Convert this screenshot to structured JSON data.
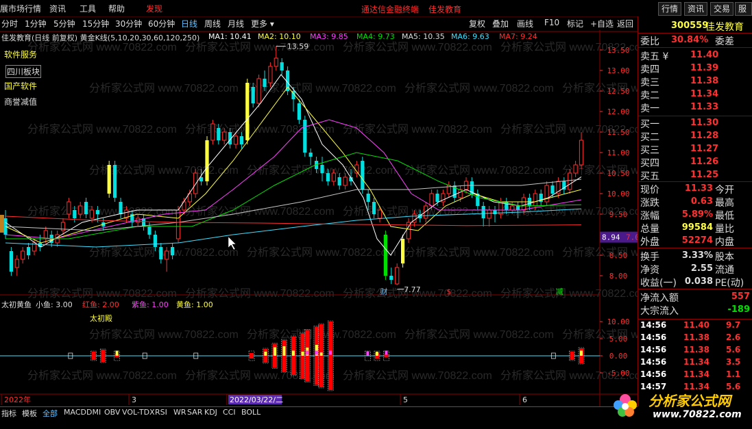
{
  "menu": {
    "items": [
      "展市场行情",
      "资讯",
      "工具",
      "帮助",
      "发现"
    ],
    "center_links": [
      "通达信金融终端",
      "佳发教育"
    ],
    "right_buttons": [
      "行情",
      "资讯",
      "交易",
      "服务"
    ]
  },
  "periods": [
    "分时",
    "1分钟",
    "5分钟",
    "15分钟",
    "30分钟",
    "60分钟",
    "日线",
    "周线",
    "月线",
    "更多 ▾"
  ],
  "active_period": "日线",
  "chart_tools": [
    "复权",
    "叠加",
    "画线",
    "F10",
    "标记",
    "+自选",
    "返回"
  ],
  "chart_title": "佳发教育(日线 前复权) 黄金K线(5,10,20,30,60,120,250)",
  "ma_labels": [
    {
      "text": "MA1: 10.41",
      "color": "#ffffff"
    },
    {
      "text": "MA2: 10.10",
      "color": "#ffff40"
    },
    {
      "text": "MA3: 9.85",
      "color": "#ff40ff"
    },
    {
      "text": "MA4: 9.73",
      "color": "#00e000"
    },
    {
      "text": "MA5: 10.35",
      "color": "#dddddd"
    },
    {
      "text": "MA6: 9.63",
      "color": "#40e0ff"
    },
    {
      "text": "MA7: 9.24",
      "color": "#ff3030"
    }
  ],
  "sectors": [
    "软件服务",
    "四川板块",
    "国产软件",
    "商誉减值"
  ],
  "price_axis": [
    "13.50",
    "13.00",
    "12.50",
    "12.00",
    "11.50",
    "11.00",
    "10.50",
    "10.00",
    "9.50",
    "9.00",
    "8.50",
    "8.00"
  ],
  "current_price_tag": "8.94",
  "current_price_tag2": "7.0",
  "high_marker": "13.59",
  "low_marker": "7.77",
  "markers": [
    "财",
    "$",
    "减"
  ],
  "indicator": {
    "name": "太初黄鱼",
    "params": [
      {
        "text": "小鱼: 3.00",
        "color": "#dddddd"
      },
      {
        "text": "红鱼: 2.00",
        "color": "#ff3030"
      },
      {
        "text": "紫鱼: 1.00",
        "color": "#ff40ff"
      },
      {
        "text": "黄鱼: 1.00",
        "color": "#ffff40"
      }
    ],
    "sub_label": "太初殿",
    "axis": [
      "10.00",
      "5.00",
      "0.00",
      "-5.00"
    ]
  },
  "time_axis": [
    "2022年",
    "3",
    "2022/03/22/二",
    "5",
    "6"
  ],
  "bottom_tabs": [
    "指标",
    "模板",
    "全部",
    "MACD",
    "DMI",
    "OBV",
    "VOL-TDX",
    "RSI",
    "WR",
    "SAR",
    "KDJ",
    "CCI",
    "BOLL"
  ],
  "stock": {
    "code": "300559",
    "name": "佳发教育"
  },
  "weibi": {
    "label": "委比",
    "value": "30.84%",
    "right": "委差"
  },
  "asks": [
    {
      "label": "卖五",
      "price": "11.40",
      "mark": "¥"
    },
    {
      "label": "卖四",
      "price": "11.39"
    },
    {
      "label": "卖三",
      "price": "11.38"
    },
    {
      "label": "卖二",
      "price": "11.34"
    },
    {
      "label": "卖一",
      "price": "11.33"
    }
  ],
  "bids": [
    {
      "label": "买一",
      "price": "11.30"
    },
    {
      "label": "买二",
      "price": "11.28"
    },
    {
      "label": "买三",
      "price": "11.27"
    },
    {
      "label": "买四",
      "price": "11.26"
    },
    {
      "label": "买五",
      "price": "11.25"
    }
  ],
  "quote": [
    {
      "label": "现价",
      "value": "11.33",
      "right": "今开",
      "color": "#ff3030"
    },
    {
      "label": "涨跌",
      "value": "0.63",
      "right": "最高",
      "color": "#ff3030"
    },
    {
      "label": "涨幅",
      "value": "5.89%",
      "right": "最低",
      "color": "#ff3030"
    },
    {
      "label": "总量",
      "value": "99584",
      "right": "量比",
      "color": "#ffff40"
    },
    {
      "label": "外盘",
      "value": "52274",
      "right": "内盘",
      "color": "#ff3030"
    },
    {
      "label": "换手",
      "value": "3.33%",
      "right": "股本",
      "color": "#dddddd"
    },
    {
      "label": "净资",
      "value": "2.55",
      "right": "流通",
      "color": "#dddddd"
    },
    {
      "label": "收益(一)",
      "value": "0.038",
      "right": "PE(动)",
      "color": "#dddddd"
    }
  ],
  "flows": [
    {
      "label": "净流入额",
      "value": "557",
      "color": "#ff3030"
    },
    {
      "label": "大宗流入",
      "value": "-189",
      "color": "#00e000"
    }
  ],
  "ticks": [
    {
      "time": "14:56",
      "price": "11.40",
      "vol": "9.7"
    },
    {
      "time": "14:56",
      "price": "11.38",
      "vol": "2.6"
    },
    {
      "time": "14:56",
      "price": "11.38",
      "vol": "5.6"
    },
    {
      "time": "14:56",
      "price": "11.34",
      "vol": "3.5"
    },
    {
      "time": "14:56",
      "price": "11.34",
      "vol": "1.1"
    },
    {
      "time": "14:57",
      "price": "11.34",
      "vol": "5.6"
    }
  ],
  "watermark": "分析家公式网 www.70822.com",
  "logo": {
    "title": "分析家公式网",
    "url": "www.70822.com"
  },
  "colors": {
    "up": "#ff3030",
    "down": "#00e0e0",
    "yellow": "#ffff40",
    "green": "#00e000",
    "bg": "#000000",
    "border": "#8b0000"
  }
}
